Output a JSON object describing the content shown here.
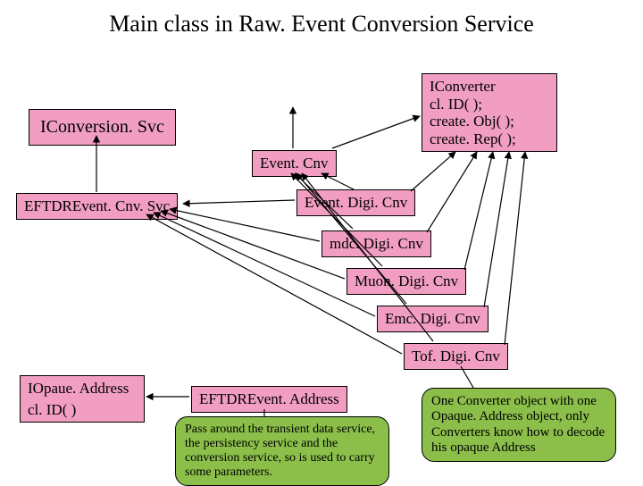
{
  "title": "Main class in Raw. Event Conversion Service",
  "boxes": {
    "iconversion_svc": "IConversion. Svc",
    "event_cnv": "Event. Cnv",
    "iconverter_l1": "IConverter",
    "iconverter_l2": "cl. ID( );",
    "iconverter_l3": "create. Obj( );",
    "iconverter_l4": "create. Rep( );",
    "eftdr_event_cnv_svc": "EFTDREvent. Cnv. Svc",
    "event_digi_cnv": "Event. Digi. Cnv",
    "mdc_digi_cnv": "mdc. Digi. Cnv",
    "muon_digi_cnv": "Muon. Digi. Cnv",
    "emc_digi_cnv": "Emc. Digi. Cnv",
    "tof_digi_cnv": "Tof. Digi. Cnv",
    "iopaque_addr_l1": "IOpaue. Address",
    "iopaque_addr_l2": "cl. ID( )",
    "eftdr_event_addr": "EFTDREvent. Address"
  },
  "callouts": {
    "left": "Pass around the transient data service, the persistency service and the conversion service, so is used to carry some parameters.",
    "right": "One Converter object with one Opaque. Address object, only Converters know how to decode his opaque Address"
  }
}
